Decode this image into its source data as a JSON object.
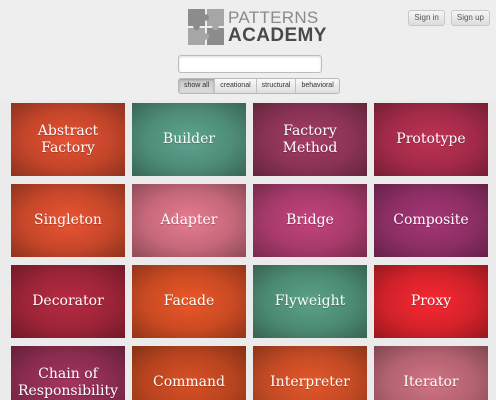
{
  "header": {
    "logo_line1": "PATTERNS",
    "logo_line2": "ACADEMY",
    "sign_in": "Sign in",
    "sign_up": "Sign up"
  },
  "search": {
    "value": "",
    "placeholder": ""
  },
  "filters": [
    "show all",
    "creational",
    "structural",
    "behavioral"
  ],
  "active_filter": "show all",
  "tiles": [
    {
      "name": "Abstract Factory",
      "color": "#c4452a"
    },
    {
      "name": "Builder",
      "color": "#4e8c78"
    },
    {
      "name": "Factory Method",
      "color": "#8a3354"
    },
    {
      "name": "Prototype",
      "color": "#a22a48"
    },
    {
      "name": "Singleton",
      "color": "#c7472a"
    },
    {
      "name": "Adapter",
      "color": "#c5687a"
    },
    {
      "name": "Bridge",
      "color": "#a63a6a"
    },
    {
      "name": "Composite",
      "color": "#8c2e64"
    },
    {
      "name": "Decorator",
      "color": "#9c2438"
    },
    {
      "name": "Facade",
      "color": "#c94a22"
    },
    {
      "name": "Flyweight",
      "color": "#4c8a72"
    },
    {
      "name": "Proxy",
      "color": "#d3222a"
    },
    {
      "name": "Chain of Responsibility",
      "color": "#8a2c4e"
    },
    {
      "name": "Command",
      "color": "#b8441f"
    },
    {
      "name": "Interpreter",
      "color": "#c24a24"
    },
    {
      "name": "Iterator",
      "color": "#b26270"
    }
  ]
}
